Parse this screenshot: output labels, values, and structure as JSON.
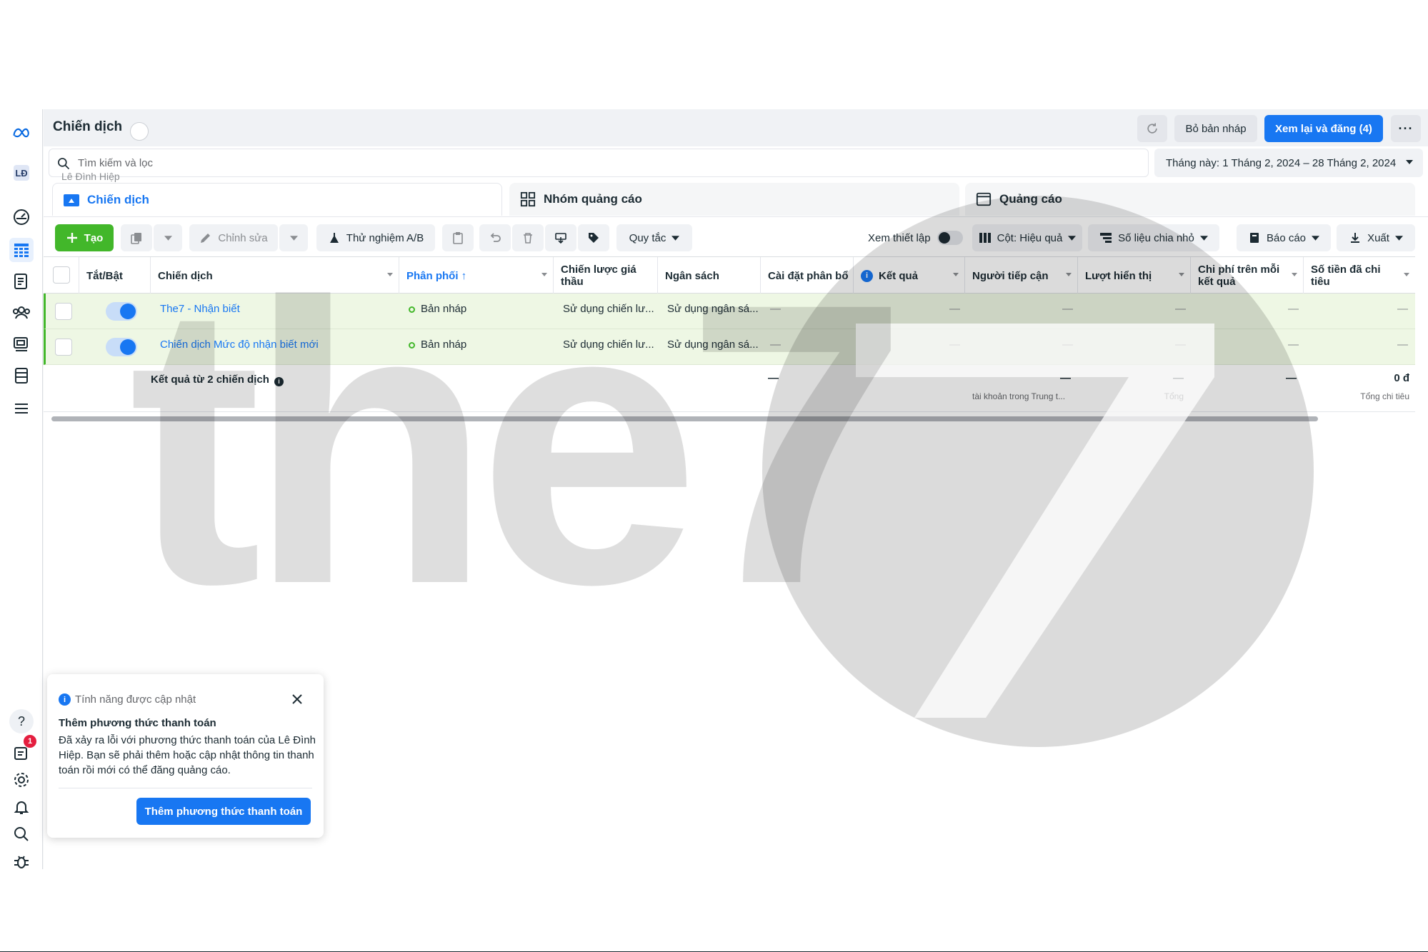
{
  "app": {
    "page_title": "Chiến dịch",
    "refresh_icon": "refresh-icon",
    "discard_label": "Bỏ bản nháp",
    "publish_label": "Xem lại và đăng (4)",
    "more_label": "···"
  },
  "search": {
    "placeholder": "Tìm kiếm và lọc",
    "account_hint": "Lê Đình Hiệp"
  },
  "date_range": "Tháng này: 1 Tháng 2, 2024 – 28 Tháng 2, 2024",
  "tabs": [
    {
      "label": "Chiến dịch",
      "icon": "folder-icon",
      "active": true
    },
    {
      "label": "Nhóm quảng cáo",
      "icon": "grid-icon",
      "active": false
    },
    {
      "label": "Quảng cáo",
      "icon": "ad-icon",
      "active": false
    }
  ],
  "toolbar": {
    "create_label": "Tạo",
    "edit_label": "Chỉnh sửa",
    "ab_test_label": "Thử nghiệm A/B",
    "rules_label": "Quy tắc",
    "view_setup_label": "Xem thiết lập",
    "columns_label": "Cột: Hiệu quả",
    "breakdown_label": "Số liệu chia nhỏ",
    "reports_label": "Báo cáo",
    "export_label": "Xuất"
  },
  "table": {
    "headers": [
      "Tắt/Bật",
      "Chiến dịch",
      "Phân phối ↑",
      "Chiến lược giá thầu",
      "Ngân sách",
      "Cài đặt phân bổ",
      "Kết quả",
      "Người tiếp cận",
      "Lượt hiển thị",
      "Chi phí trên mỗi kết quả",
      "Số tiền đã chi tiêu"
    ],
    "rows": [
      {
        "name": "The7 - Nhận biết",
        "delivery": "Bản nháp",
        "bid": "Sử dụng chiến lư...",
        "budget": "Sử dụng ngân sá...",
        "attribution": "—",
        "results": "—",
        "reach": "—",
        "impressions": "—",
        "cpr": "—",
        "spent": "—",
        "enabled": true
      },
      {
        "name": "Chiến dịch Mức độ nhận biết mới",
        "delivery": "Bản nháp",
        "bid": "Sử dụng chiến lư...",
        "budget": "Sử dụng ngân sá...",
        "attribution": "—",
        "results": "—",
        "reach": "—",
        "impressions": "—",
        "cpr": "—",
        "spent": "—",
        "enabled": true
      }
    ],
    "summary": {
      "title": "Kết quả từ 2 chiến dịch",
      "attribution": "—",
      "reach": "—",
      "reach_sub": "tài khoản trong Trung t...",
      "impressions": "—",
      "impressions_sub": "Tổng",
      "cpr": "—",
      "spent": "0 đ",
      "spent_sub": "Tổng chi tiêu"
    }
  },
  "popup": {
    "title": "Tính năng được cập nhật",
    "heading": "Thêm phương thức thanh toán",
    "body": "Đã xảy ra lỗi với phương thức thanh toán của Lê Đình Hiệp. Bạn sẽ phải thêm hoặc cập nhật thông tin thanh toán rồi mới có thể đăng quảng cáo.",
    "button_label": "Thêm phương thức thanh toán"
  },
  "rail": {
    "notification_count": "1",
    "icons": [
      "meta-logo-icon",
      "account-avatar-icon",
      "dashboard-icon",
      "table-icon",
      "ad-pages-icon",
      "audience-icon",
      "catalog-icon",
      "billing-icon",
      "menu-icon",
      "help-icon",
      "notifications-icon",
      "settings-icon",
      "bell-icon",
      "search-icon",
      "bug-icon"
    ]
  },
  "watermark": "the7",
  "colors": {
    "accent": "#1877f2",
    "create": "#42b72a",
    "draft_row": "#eef7e4"
  }
}
